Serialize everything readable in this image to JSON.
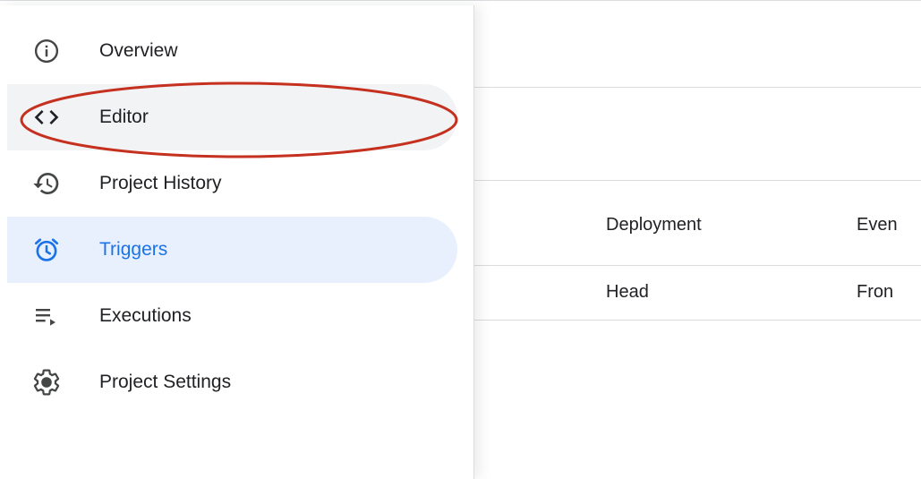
{
  "sidebar": {
    "items": [
      {
        "label": "Overview",
        "icon": "info-circle-icon",
        "state": "default"
      },
      {
        "label": "Editor",
        "icon": "code-brackets-icon",
        "state": "hovered"
      },
      {
        "label": "Project History",
        "icon": "history-icon",
        "state": "default"
      },
      {
        "label": "Triggers",
        "icon": "alarm-clock-icon",
        "state": "active"
      },
      {
        "label": "Executions",
        "icon": "list-play-icon",
        "state": "default"
      },
      {
        "label": "Project Settings",
        "icon": "gear-icon",
        "state": "default"
      }
    ]
  },
  "table": {
    "columns": [
      {
        "label": "Deployment"
      },
      {
        "label": "Even"
      }
    ],
    "rows": [
      {
        "cells": [
          "Head",
          "Fron"
        ]
      }
    ]
  },
  "colors": {
    "active_bg": "#e8f0fe",
    "active_text": "#1a73e8",
    "hover_bg": "#f1f3f4",
    "text": "#202124",
    "icon": "#444746",
    "divider": "#dadce0",
    "annotation": "#c5301f"
  },
  "annotation": {
    "shape": "ellipse",
    "target": "Editor"
  }
}
